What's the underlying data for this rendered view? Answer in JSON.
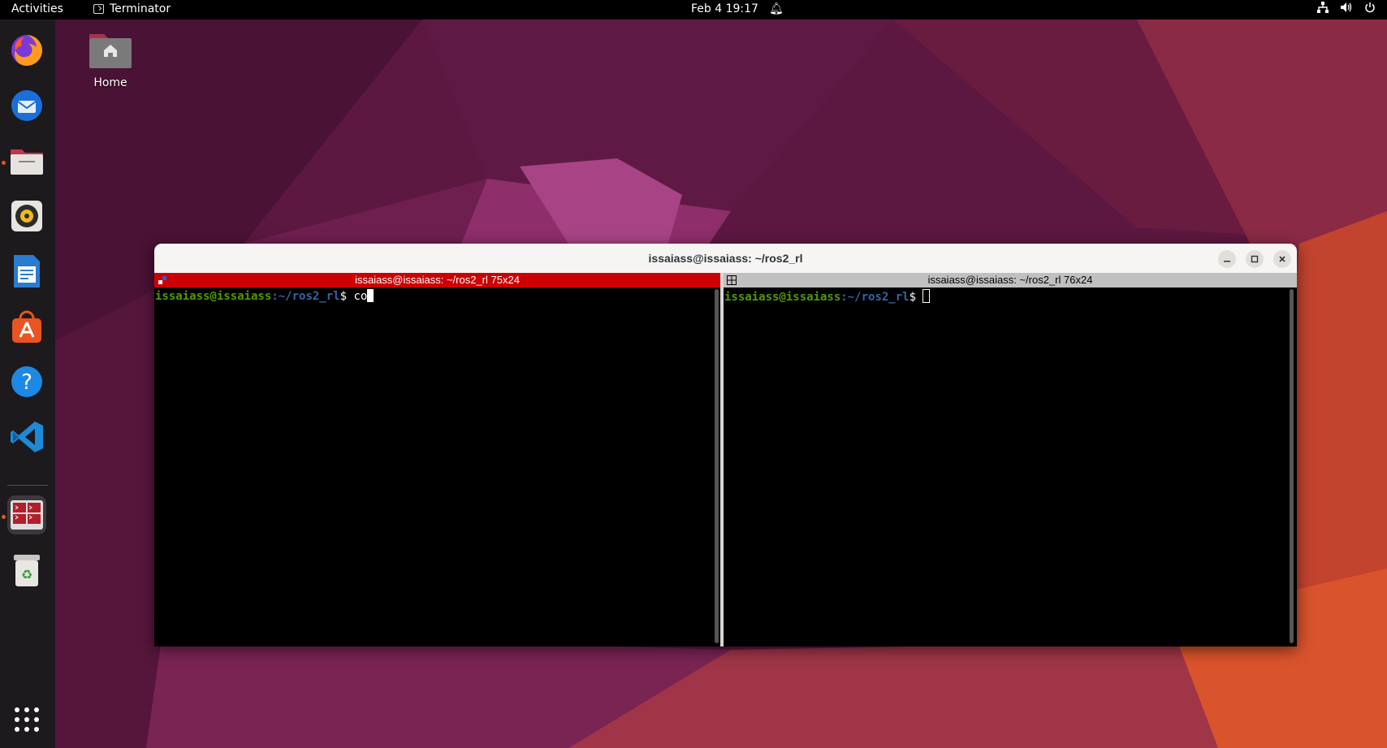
{
  "topbar": {
    "activities": "Activities",
    "app_name": "Terminator",
    "clock": "Feb 4  19:17"
  },
  "dock": {
    "items": [
      "firefox",
      "thunderbird",
      "files",
      "rhythmbox",
      "libreoffice-writer",
      "app-center",
      "help",
      "vscode",
      "terminator",
      "trash"
    ]
  },
  "desktop": {
    "home_label": "Home"
  },
  "window": {
    "title": "issaiass@issaiass: ~/ros2_rl"
  },
  "panes": {
    "left": {
      "header": "issaiass@issaiass: ~/ros2_rl 75x24",
      "prompt_user": "issaiass@issaiass",
      "prompt_path": ":~/ros2_rl",
      "prompt_symbol": "$ ",
      "input": "co",
      "active": true
    },
    "right": {
      "header": "issaiass@issaiass: ~/ros2_rl 76x24",
      "prompt_user": "issaiass@issaiass",
      "prompt_path": ":~/ros2_rl",
      "prompt_symbol": "$ ",
      "input": "",
      "active": false
    }
  },
  "colors": {
    "active_header": "#cc0000",
    "inactive_header": "#c0c0c0",
    "prompt_user": "#4e9a06",
    "prompt_path": "#3465a4"
  }
}
